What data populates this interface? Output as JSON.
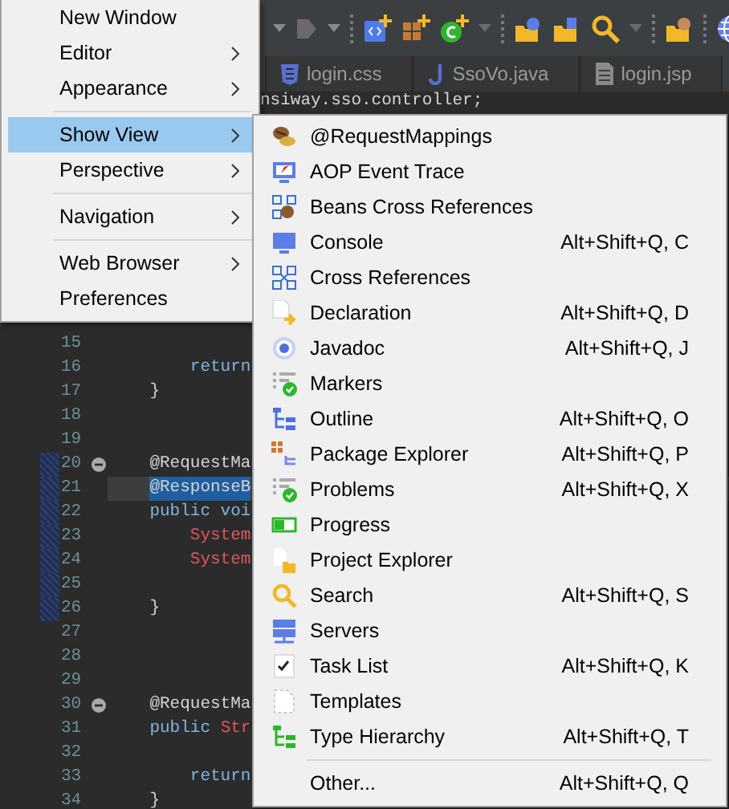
{
  "editor_tabs": [
    {
      "label": "login.css",
      "kind": "css"
    },
    {
      "label": "SsoVo.java",
      "kind": "java"
    },
    {
      "label": "login.jsp",
      "kind": "jsp"
    }
  ],
  "package_fragment": "nsiway.sso.controller;",
  "code_lines": [
    {
      "number": "15",
      "fold": false,
      "changed": false,
      "selected": false
    },
    {
      "number": "16",
      "tokens": [
        {
          "text": "        return",
          "kind": "keyword"
        }
      ],
      "fold": false,
      "changed": false,
      "selected": false
    },
    {
      "number": "17",
      "tokens": [
        {
          "text": "    }",
          "kind": "plain"
        }
      ],
      "fold": false,
      "changed": false,
      "selected": false
    },
    {
      "number": "18",
      "fold": false,
      "changed": false,
      "selected": false
    },
    {
      "number": "19",
      "fold": false,
      "changed": false,
      "selected": false
    },
    {
      "number": "20",
      "tokens": [
        {
          "text": "    @RequestMa",
          "kind": "annotation"
        }
      ],
      "fold": true,
      "changed": true,
      "selected": false
    },
    {
      "number": "21",
      "tokens": [
        {
          "text": "@ResponseB",
          "kind": "annotation"
        }
      ],
      "fold": false,
      "changed": true,
      "selected": true
    },
    {
      "number": "22",
      "tokens": [
        {
          "text": "    public voi",
          "kind": "keyword"
        }
      ],
      "fold": false,
      "changed": true,
      "selected": false
    },
    {
      "number": "23",
      "tokens": [
        {
          "text": "        System",
          "kind": "type"
        }
      ],
      "fold": false,
      "changed": true,
      "selected": false
    },
    {
      "number": "24",
      "tokens": [
        {
          "text": "        System",
          "kind": "type"
        }
      ],
      "fold": false,
      "changed": true,
      "selected": false
    },
    {
      "number": "25",
      "fold": false,
      "changed": true,
      "selected": false
    },
    {
      "number": "26",
      "tokens": [
        {
          "text": "    }",
          "kind": "plain"
        }
      ],
      "fold": false,
      "changed": true,
      "selected": false
    },
    {
      "number": "27",
      "fold": false,
      "changed": false,
      "selected": false
    },
    {
      "number": "28",
      "fold": false,
      "changed": false,
      "selected": false
    },
    {
      "number": "29",
      "fold": false,
      "changed": false,
      "selected": false
    },
    {
      "number": "30",
      "tokens": [
        {
          "text": "    @RequestMa",
          "kind": "annotation"
        }
      ],
      "fold": true,
      "changed": false,
      "selected": false
    },
    {
      "number": "31",
      "tokens": [
        {
          "text": "    public",
          "kind": "keyword"
        },
        {
          "text": " Str",
          "kind": "type"
        }
      ],
      "fold": false,
      "changed": false,
      "selected": false
    },
    {
      "number": "32",
      "fold": false,
      "changed": false,
      "selected": false
    },
    {
      "number": "33",
      "tokens": [
        {
          "text": "        return",
          "kind": "keyword"
        }
      ],
      "fold": false,
      "changed": false,
      "selected": false
    },
    {
      "number": "34",
      "tokens": [
        {
          "text": "    }",
          "kind": "plain"
        }
      ],
      "fold": false,
      "changed": false,
      "selected": false
    }
  ],
  "window_menu": {
    "groups": [
      [
        {
          "label": "New Window",
          "submenu": false,
          "selected": false
        },
        {
          "label": "Editor",
          "submenu": true,
          "selected": false
        },
        {
          "label": "Appearance",
          "submenu": true,
          "selected": false
        }
      ],
      [
        {
          "label": "Show View",
          "submenu": true,
          "selected": true
        },
        {
          "label": "Perspective",
          "submenu": true,
          "selected": false
        }
      ],
      [
        {
          "label": "Navigation",
          "submenu": true,
          "selected": false
        }
      ],
      [
        {
          "label": "Web Browser",
          "submenu": true,
          "selected": false
        },
        {
          "label": "Preferences",
          "submenu": false,
          "selected": false
        }
      ]
    ]
  },
  "show_view_menu": {
    "groups": [
      [
        {
          "label": "@RequestMappings"
        },
        {
          "label": "AOP Event Trace"
        },
        {
          "label": "Beans Cross References"
        },
        {
          "label": "Console",
          "shortcut": "Alt+Shift+Q, C"
        },
        {
          "label": "Cross References"
        },
        {
          "label": "Declaration",
          "shortcut": "Alt+Shift+Q, D"
        },
        {
          "label": "Javadoc",
          "shortcut": "Alt+Shift+Q, J"
        },
        {
          "label": "Markers"
        },
        {
          "label": "Outline",
          "shortcut": "Alt+Shift+Q, O"
        },
        {
          "label": "Package Explorer",
          "shortcut": "Alt+Shift+Q, P"
        },
        {
          "label": "Problems",
          "shortcut": "Alt+Shift+Q, X"
        },
        {
          "label": "Progress"
        },
        {
          "label": "Project Explorer"
        },
        {
          "label": "Search",
          "shortcut": "Alt+Shift+Q, S"
        },
        {
          "label": "Servers"
        },
        {
          "label": "Task List",
          "shortcut": "Alt+Shift+Q, K"
        },
        {
          "label": "Templates"
        },
        {
          "label": "Type Hierarchy",
          "shortcut": "Alt+Shift+Q, T"
        }
      ],
      [
        {
          "label": "Other...",
          "shortcut": "Alt+Shift+Q, Q"
        }
      ]
    ]
  }
}
